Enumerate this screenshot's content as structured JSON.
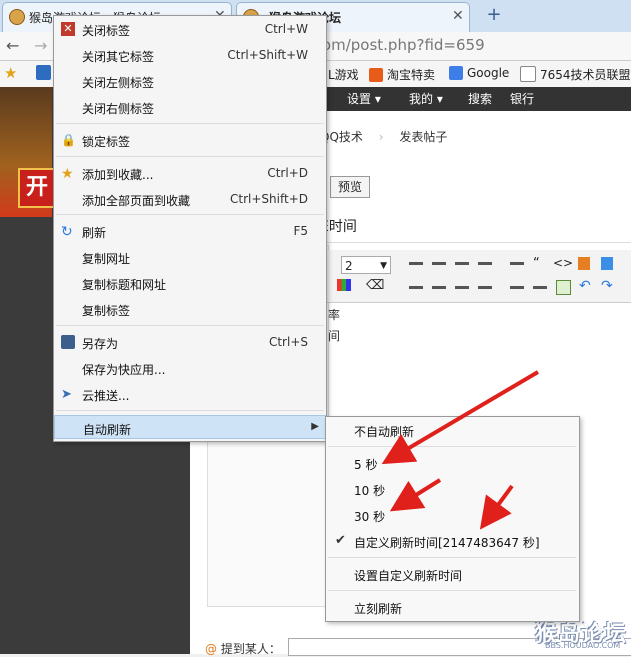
{
  "tabs": [
    {
      "title": "猴岛游戏论坛 - 猴岛论坛",
      "active": true
    },
    {
      "title": "猴岛游戏论坛",
      "active": false
    }
  ],
  "address": {
    "url": "o.com/post.php?fid=659"
  },
  "bookmarks": [
    {
      "label": "L游戏",
      "icon": "game-icon"
    },
    {
      "label": "淘宝特卖",
      "icon": "taobao-icon"
    },
    {
      "label": "Google",
      "icon": "google-icon"
    },
    {
      "label": "7654技术员联盟",
      "icon": "page-icon"
    }
  ],
  "forum_nav": [
    {
      "label": "设置 ▾"
    },
    {
      "label": "我的 ▾"
    },
    {
      "label": "搜索"
    },
    {
      "label": "银行"
    }
  ],
  "breadcrumb": {
    "item1": "QQ技术",
    "item2": "发表帖子"
  },
  "preview_button": "预览",
  "title_partial": "E时间",
  "font_size_value": "2",
  "editor_partial_lines": [
    "率",
    "间"
  ],
  "mention_label": "提到某人：",
  "watermark": {
    "main": "猴岛论坛",
    "sub": "BBS.HOUDAO.COM"
  },
  "banner_text": "开",
  "context_menu": {
    "items": [
      {
        "label": "关闭标签",
        "shortcut": "Ctrl+W",
        "icon": "close-icon"
      },
      {
        "label": "关闭其它标签",
        "shortcut": "Ctrl+Shift+W"
      },
      {
        "label": "关闭左侧标签",
        "shortcut": ""
      },
      {
        "label": "关闭右侧标签",
        "shortcut": ""
      },
      {
        "label": "锁定标签",
        "shortcut": "",
        "icon": "lock-icon"
      },
      {
        "label": "添加到收藏...",
        "shortcut": "Ctrl+D",
        "icon": "star-add-icon"
      },
      {
        "label": "添加全部页面到收藏",
        "shortcut": "Ctrl+Shift+D"
      },
      {
        "label": "刷新",
        "shortcut": "F5",
        "icon": "refresh-icon"
      },
      {
        "label": "复制网址",
        "shortcut": ""
      },
      {
        "label": "复制标题和网址",
        "shortcut": ""
      },
      {
        "label": "复制标签",
        "shortcut": ""
      },
      {
        "label": "另存为",
        "shortcut": "Ctrl+S",
        "icon": "save-icon"
      },
      {
        "label": "保存为快应用...",
        "shortcut": ""
      },
      {
        "label": "云推送...",
        "shortcut": "",
        "icon": "send-icon"
      },
      {
        "label": "自动刷新",
        "shortcut": ""
      }
    ]
  },
  "submenu": {
    "items": [
      {
        "label": "不自动刷新"
      },
      {
        "label": "5 秒"
      },
      {
        "label": "10 秒"
      },
      {
        "label": "30 秒"
      },
      {
        "label": "自定义刷新时间[2147483647 秒]",
        "checked": true
      },
      {
        "label": "设置自定义刷新时间"
      },
      {
        "label": "立刻刷新"
      }
    ]
  },
  "colors": {
    "accent": "#cfe3f7",
    "arrow": "#e0201b",
    "forum_nav": "#333333"
  }
}
